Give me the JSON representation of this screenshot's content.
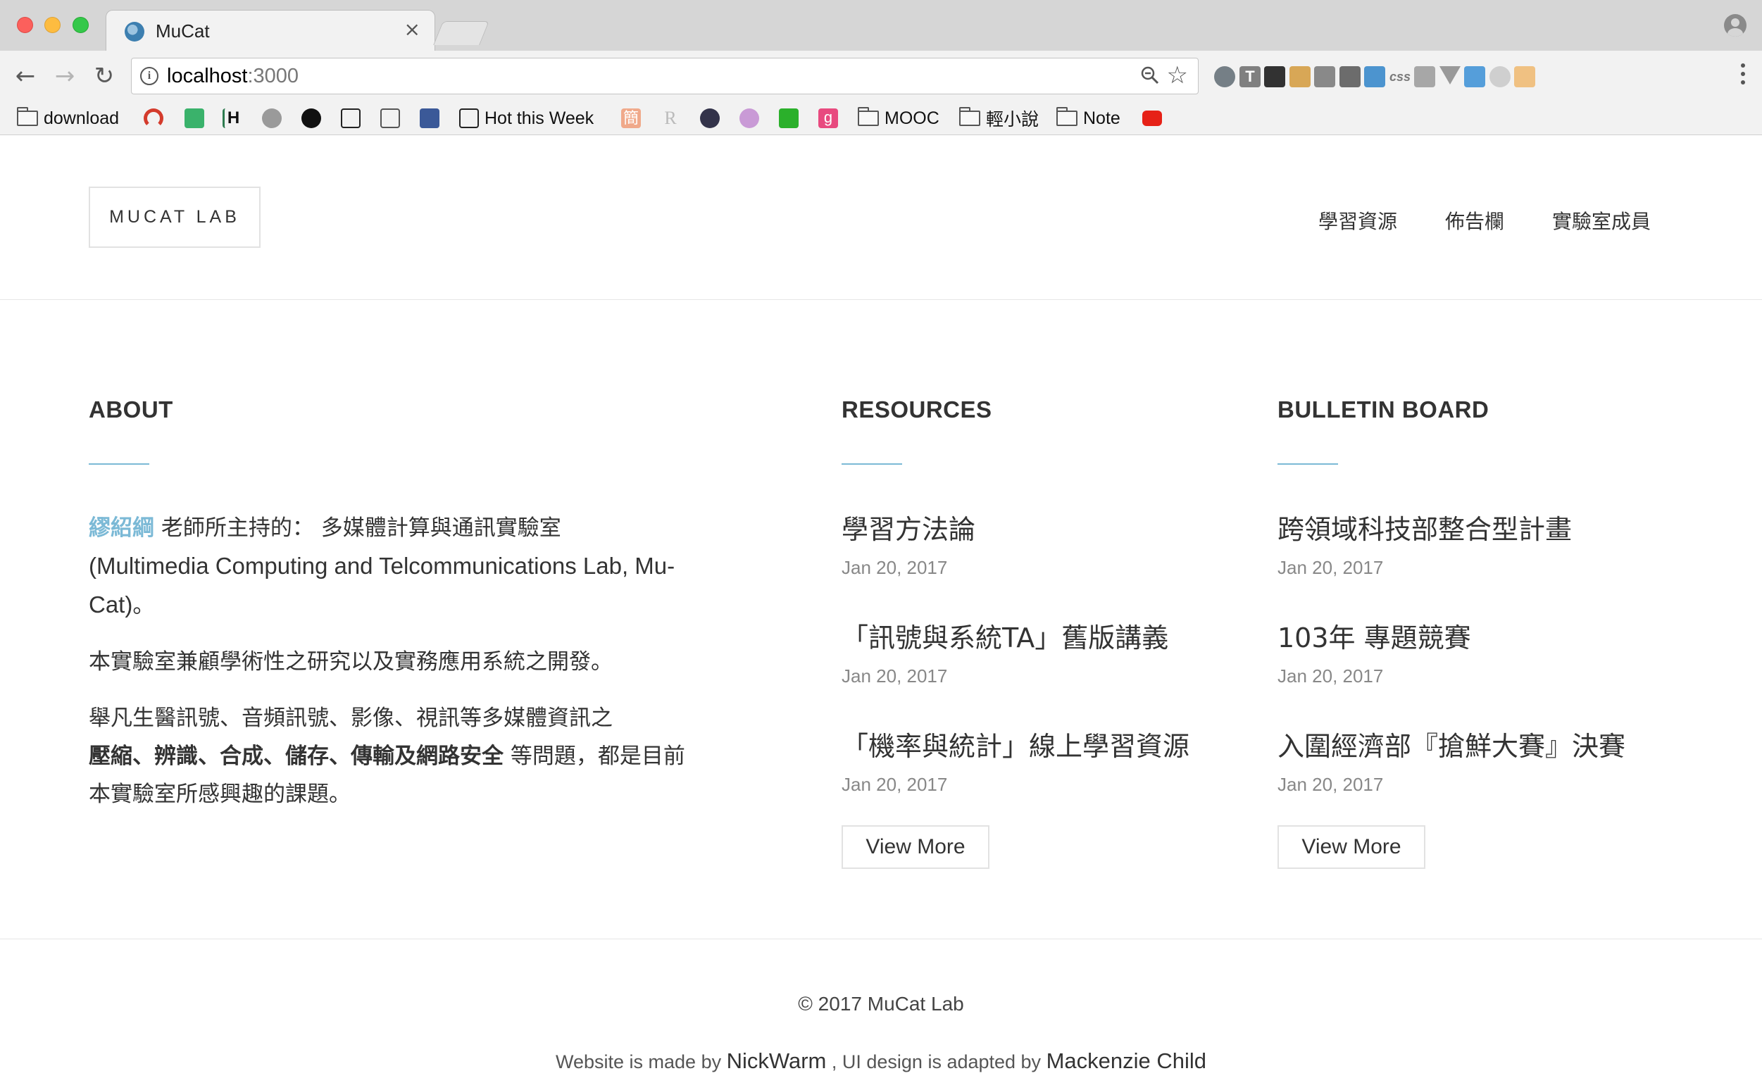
{
  "browser": {
    "tab_title": "MuCat",
    "tab_close": "×",
    "url_host": "localhost",
    "url_port": ":3000",
    "info_glyph": "i",
    "star_glyph": "☆",
    "nav": {
      "back": "←",
      "forward": "→",
      "reload": "↻"
    },
    "extensions": [
      {
        "name": "refresh-ext-icon",
        "color": "#5f6b73"
      },
      {
        "name": "t-ext-icon",
        "color": "#6d6d6d"
      },
      {
        "name": "bird-ext-icon",
        "color": "#111111"
      },
      {
        "name": "ruler-ext-icon",
        "color": "#d39a3b"
      },
      {
        "name": "crosshair-ext-icon",
        "color": "#777777"
      },
      {
        "name": "columns-ext-icon",
        "color": "#555555"
      },
      {
        "name": "css3-ext-icon",
        "color": "#2f84c9"
      },
      {
        "name": "css-text-ext-icon",
        "color": "#666666"
      },
      {
        "name": "grid-ext-icon",
        "color": "#9a9a9a"
      },
      {
        "name": "vue-ext-icon",
        "color": "#8a8a8a"
      },
      {
        "name": "window-ext-icon",
        "color": "#3a8fd6"
      },
      {
        "name": "globe-ext-icon",
        "color": "#c9c9c9"
      },
      {
        "name": "face-ext-icon",
        "color": "#f0b86e"
      }
    ],
    "ext_labels": {
      "t": "T",
      "css": "css"
    }
  },
  "bookmarks": {
    "download": "download",
    "hot": "Hot this Week",
    "h": "H",
    "jian": "簡",
    "r": "R",
    "g": "g",
    "mooc": "MOOC",
    "novel": "輕小說",
    "note": "Note",
    "icons": [
      {
        "name": "red-arc-bookmark-icon",
        "color": "#d43b2c"
      },
      {
        "name": "green-leaf-bookmark-icon",
        "color": "#3ab26b"
      },
      {
        "name": "gear-bookmark-icon",
        "color": "#9a9a9a"
      },
      {
        "name": "github-bookmark-icon",
        "color": "#111111"
      },
      {
        "name": "l-bookmark-icon",
        "color": "#222222"
      },
      {
        "name": "book-bookmark-icon",
        "color": "#555555"
      },
      {
        "name": "facebook-bookmark-icon",
        "color": "#3b5998"
      },
      {
        "name": "shield-bookmark-icon",
        "color": "#33334a"
      },
      {
        "name": "circle-bookmark-icon",
        "color": "#c99ad6"
      },
      {
        "name": "green-dot-bookmark-icon",
        "color": "#2bb02b"
      },
      {
        "name": "youtube-bookmark-icon",
        "color": "#e62117"
      }
    ]
  },
  "site": {
    "logo": "MUCAT LAB",
    "nav": [
      "學習資源",
      "佈告欄",
      "實驗室成員"
    ]
  },
  "about": {
    "heading": "ABOUT",
    "professor": "繆紹綱",
    "p1_cn": " 老師所主持的： 多媒體計算與通訊實驗室",
    "p1_en": "(Multimedia Computing and Telcommunications Lab, Mu-Cat)",
    "p1_end": "。",
    "p2": "本實驗室兼顧學術性之研究以及實務應用系統之開發。",
    "p3_a": "舉凡生醫訊號、音頻訊號、影像、視訊等多媒體資訊之",
    "p3_bold": "壓縮、辨識、合成、儲存、傳輸及網路安全",
    "p3_b": " 等問題，都是目前本實驗室所感興趣的課題。"
  },
  "resources": {
    "heading": "RESOURCES",
    "items": [
      {
        "title": "學習方法論",
        "date": "Jan 20, 2017"
      },
      {
        "title": "「訊號與系統TA」舊版講義",
        "date": "Jan 20, 2017"
      },
      {
        "title": "「機率與統計」線上學習資源",
        "date": "Jan 20, 2017"
      }
    ],
    "button": "View More"
  },
  "bulletin": {
    "heading": "BULLETIN BOARD",
    "items": [
      {
        "title": "跨領域科技部整合型計畫",
        "date": "Jan 20, 2017"
      },
      {
        "title": "103年 專題競賽",
        "date": "Jan 20, 2017"
      },
      {
        "title": "入圍經濟部『搶鮮大賽』決賽",
        "date": "Jan 20, 2017"
      }
    ],
    "button": "View More"
  },
  "footer": {
    "copyright": "© 2017 MuCat Lab",
    "made_by_prefix": "Website is made by ",
    "made_by": "NickWarm",
    "design_prefix": " , UI design is adapted by ",
    "design_by": "Mackenzie Child"
  },
  "colors": {
    "accent": "#7bb9d6",
    "text": "#333333",
    "date": "#888888"
  }
}
